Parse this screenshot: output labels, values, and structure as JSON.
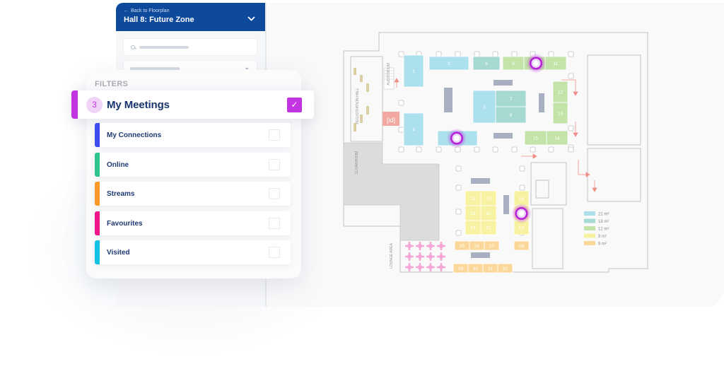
{
  "side_panel": {
    "back_label": "Back to Floorplan",
    "back_icon": "arrow-left-icon",
    "hall_title": "Hall 8: Future Zone",
    "hall_chevron": "chevron-down-icon",
    "search_icon": "search-icon",
    "select_chevron": "chevron-down-icon"
  },
  "filters": {
    "title": "FILTERS",
    "highlighted": {
      "label": "My Meetings",
      "count": "3",
      "checked": true,
      "check_glyph": "✓",
      "color": "#c234e0"
    },
    "items": [
      {
        "label": "My Connections",
        "color": "#3b4cf0",
        "checked": false
      },
      {
        "label": "Online",
        "color": "#2fc48e",
        "checked": false
      },
      {
        "label": "Streams",
        "color": "#ff9a2a",
        "checked": false
      },
      {
        "label": "Favourites",
        "color": "#f0158a",
        "checked": false
      },
      {
        "label": "Visited",
        "color": "#14c2e6",
        "checked": false
      }
    ]
  },
  "map": {
    "room_labels": {
      "registration": "REGISTRATION HALL",
      "auditorium": "AUDITORIUM",
      "cloakroom": "CLOAKROOM",
      "lounge": "LOUNGE AREA",
      "id_sign": "[id]"
    },
    "booths": [
      {
        "id": "1",
        "size": "21"
      },
      {
        "id": "2",
        "size": "21"
      },
      {
        "id": "3",
        "size": "21"
      },
      {
        "id": "4",
        "size": "21"
      },
      {
        "id": "5",
        "size": "21"
      },
      {
        "id": "6",
        "size": "18"
      },
      {
        "id": "7",
        "size": "18"
      },
      {
        "id": "8",
        "size": "18"
      },
      {
        "id": "9",
        "size": "12"
      },
      {
        "id": "10",
        "size": "12"
      },
      {
        "id": "11",
        "size": "12"
      },
      {
        "id": "12",
        "size": "12"
      },
      {
        "id": "13",
        "size": "12"
      },
      {
        "id": "14",
        "size": "12"
      },
      {
        "id": "15",
        "size": "12"
      },
      {
        "id": "16",
        "size": "9"
      },
      {
        "id": "17",
        "size": "9"
      },
      {
        "id": "18",
        "size": "9"
      },
      {
        "id": "19",
        "size": "9"
      },
      {
        "id": "20",
        "size": "9"
      },
      {
        "id": "21",
        "size": "9"
      },
      {
        "id": "22",
        "size": "9"
      },
      {
        "id": "23",
        "size": "9"
      },
      {
        "id": "24",
        "size": "9"
      },
      {
        "id": "25",
        "size": "6"
      },
      {
        "id": "26",
        "size": "6"
      },
      {
        "id": "27",
        "size": "6"
      },
      {
        "id": "28",
        "size": "6"
      },
      {
        "id": "29",
        "size": "6"
      },
      {
        "id": "30",
        "size": "6"
      },
      {
        "id": "31",
        "size": "6"
      },
      {
        "id": "32",
        "size": "6"
      }
    ],
    "meeting_pins": [
      "10",
      "5",
      "17"
    ],
    "legend": [
      {
        "label": "21 m²",
        "color": "#abe0ec"
      },
      {
        "label": "18 m²",
        "color": "#a5d9d2"
      },
      {
        "label": "12 m²",
        "color": "#c3e3a8"
      },
      {
        "label": "9 m²",
        "color": "#f6f2a1"
      },
      {
        "label": "6 m²",
        "color": "#fcd79a"
      }
    ],
    "next_icon": "chevron-right-icon"
  }
}
